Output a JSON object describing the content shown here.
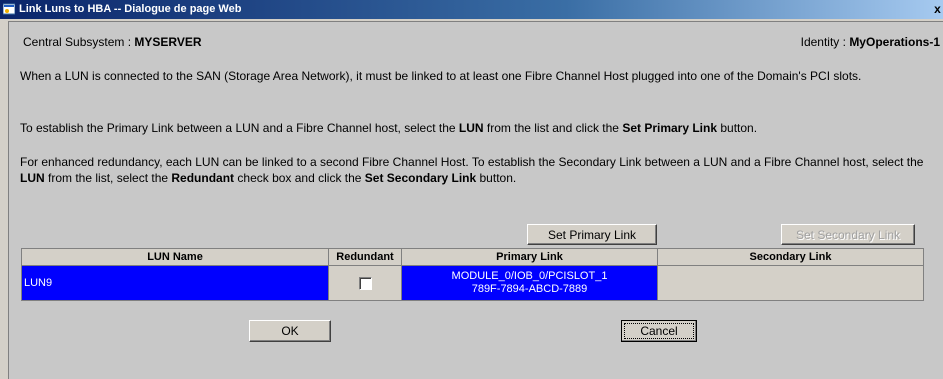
{
  "window": {
    "title": "Link Luns to HBA -- Dialogue de page Web",
    "close_label": "x"
  },
  "header": {
    "subsystem_label": "Central Subsystem : ",
    "subsystem_value": "MYSERVER",
    "identity_label": "Identity : ",
    "identity_value": "MyOperations-1"
  },
  "instructions": {
    "p1": "When a LUN is connected to the SAN (Storage Area Network), it must be linked to at least one Fibre Channel Host plugged into one of the Domain's PCI slots.",
    "p2_a": "To establish the Primary Link between a LUN and a Fibre Channel host, select the ",
    "p2_b": "LUN",
    "p2_c": " from the list and click the ",
    "p2_d": "Set Primary Link",
    "p2_e": " button.",
    "p3_a": "For enhanced redundancy, each LUN can be linked to a second Fibre Channel Host. To establish the Secondary Link between a LUN and a Fibre Channel host, select the ",
    "p3_b": "LUN",
    "p3_c": " from the list, select the ",
    "p3_d": "Redundant",
    "p3_e": " check box and click the ",
    "p3_f": "Set Secondary Link",
    "p3_g": " button."
  },
  "actions": {
    "set_primary": "Set Primary Link",
    "set_secondary": "Set Secondary Link",
    "set_secondary_enabled": false
  },
  "table": {
    "columns": [
      "LUN Name",
      "Redundant",
      "Primary Link",
      "Secondary Link"
    ],
    "rows": [
      {
        "lun_name": "LUN9",
        "redundant": false,
        "primary_link_line1": "MODULE_0/IOB_0/PCISLOT_1",
        "primary_link_line2": "789F-7894-ABCD-7889",
        "secondary_link": "",
        "selected": true
      }
    ]
  },
  "footer": {
    "ok": "OK",
    "cancel": "Cancel"
  },
  "colors": {
    "selection": "#0000ff",
    "dialog_bg": "#c8c8c8",
    "titlebar": "#0a246a"
  }
}
